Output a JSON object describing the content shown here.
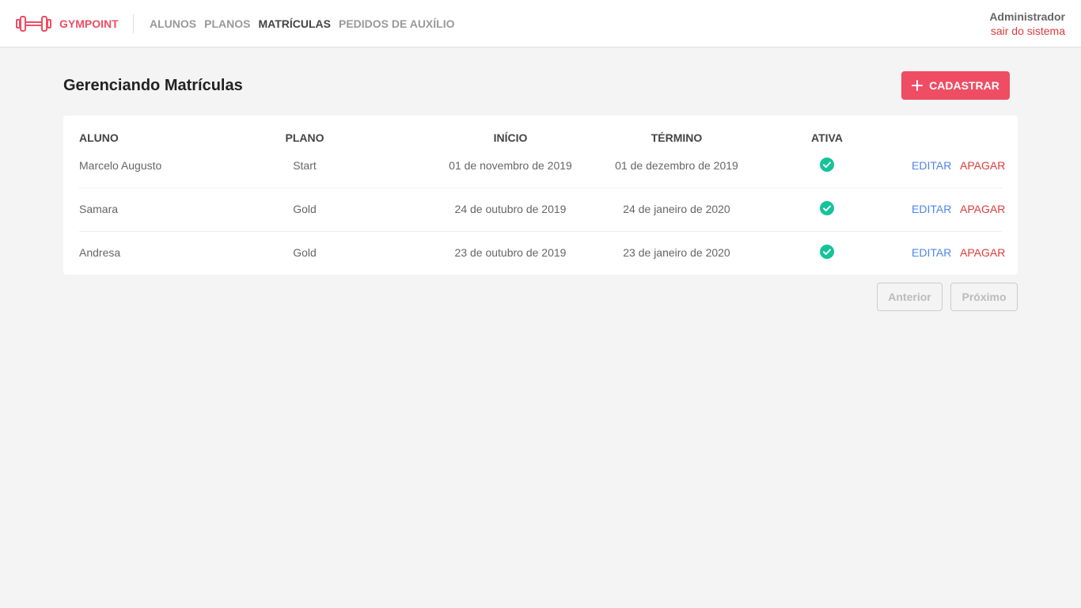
{
  "app": {
    "brand": "GYMPOINT",
    "accent_color": "#ee4d64"
  },
  "nav": {
    "items": [
      {
        "label": "ALUNOS",
        "active": false
      },
      {
        "label": "PLANOS",
        "active": false
      },
      {
        "label": "MATRÍCULAS",
        "active": true
      },
      {
        "label": "PEDIDOS DE AUXÍLIO",
        "active": false
      }
    ]
  },
  "user": {
    "name": "Administrador",
    "logout_label": "sair do sistema"
  },
  "page": {
    "title": "Gerenciando Matrículas",
    "add_button_label": "CADASTRAR"
  },
  "table": {
    "columns": {
      "aluno": "ALUNO",
      "plano": "PLANO",
      "inicio": "INÍCIO",
      "termino": "TÉRMINO",
      "ativa": "ATIVA"
    },
    "rows": [
      {
        "aluno": "Marcelo Augusto",
        "plano": "Start",
        "inicio": "01 de novembro de 2019",
        "termino": "01 de dezembro de 2019",
        "ativa": true,
        "edit": "EDITAR",
        "delete": "APAGAR"
      },
      {
        "aluno": "Samara",
        "plano": "Gold",
        "inicio": "24 de outubro de 2019",
        "termino": "24 de janeiro de 2020",
        "ativa": true,
        "edit": "EDITAR",
        "delete": "APAGAR"
      },
      {
        "aluno": "Andresa",
        "plano": "Gold",
        "inicio": "23 de outubro de 2019",
        "termino": "23 de janeiro de 2020",
        "ativa": true,
        "edit": "EDITAR",
        "delete": "APAGAR"
      }
    ],
    "active_color": "#15c39a"
  },
  "pagination": {
    "prev_label": "Anterior",
    "next_label": "Próximo"
  }
}
